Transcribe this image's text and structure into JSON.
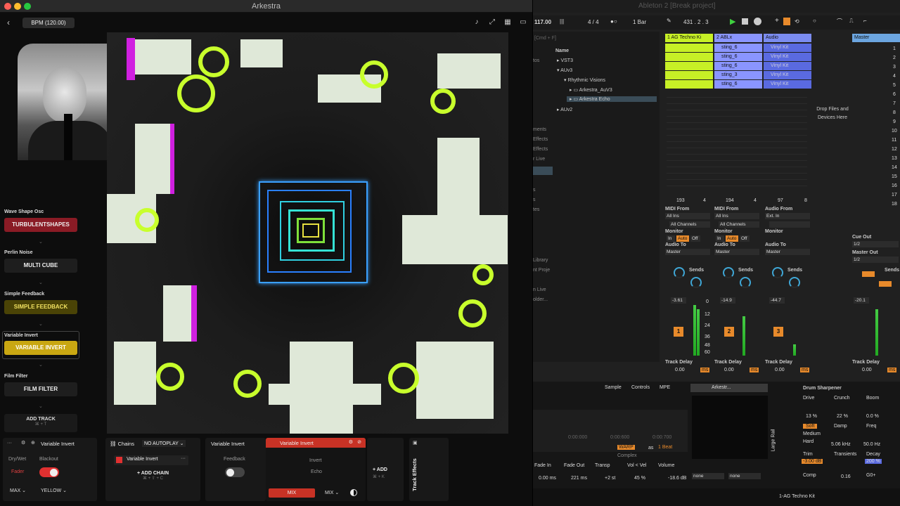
{
  "arkestra": {
    "title": "Arkestra",
    "bpm": "BPM (120.00)",
    "tracks": [
      {
        "label": "Wave Shape Osc",
        "button": "TURBULENTSHAPES",
        "color": "#8a1b25"
      },
      {
        "label": "Perlin Noise",
        "button": "MULTI CUBE",
        "color": "#1e1e1e"
      },
      {
        "label": "Simple Feedback",
        "button": "SIMPLE FEEDBACK",
        "color": "#4a4306"
      },
      {
        "label": "Variable Invert",
        "button": "VARIABLE INVERT",
        "color": "#c9a712"
      },
      {
        "label": "Film Filter",
        "button": "FILM FILTER",
        "color": "#1e1e1e"
      }
    ],
    "add_track": "ADD TRACK",
    "add_track_shortcut": "⌘ + T",
    "bottom": {
      "track_header": "Variable Invert",
      "dry_wet": "Dry/Wet",
      "blackout": "Blackout",
      "fader": "Fader",
      "max": "MAX",
      "yellow": "YELLOW",
      "chains": "Chains",
      "no_autoplay": "NO AUTOPLAY",
      "chain_item": "Variable Invert",
      "add_chain": "+ ADD CHAIN",
      "add_chain_shortcut": "⌘ + ⇧ + C",
      "effect_header": "Variable Invert",
      "feedback": "Feedback",
      "active_effect": "Variable Invert",
      "invert": "Invert",
      "echo": "Echo",
      "mix": "MIX",
      "mix2": "MIX",
      "add": "+ ADD",
      "add_shortcut": "⌘ + K",
      "track_effects": "Track Effects"
    }
  },
  "ableton": {
    "title": "Ableton 2 [Break project]",
    "tempo": "117.00",
    "signature": "4 / 4",
    "bar": "1 Bar",
    "position": "431 .  2 .  3",
    "browser": {
      "search": "[Cmd + F]",
      "name_header": "Name",
      "items": [
        "VST3",
        "AUv3",
        "Rhythmic Visions",
        "Arkestra_AuV3",
        "Arkestra Echo",
        "AUv2"
      ],
      "side": [
        "tos",
        "ments",
        "Effects",
        "Effects",
        "r Live",
        "s",
        "s",
        "tes",
        "Library",
        "nt Proje",
        "n Live",
        "older..."
      ]
    },
    "tracks": [
      {
        "name": "1 AG Techno Ki",
        "color": "#c7f026",
        "clips": [
          "",
          "",
          "",
          "",
          ""
        ],
        "number": "1"
      },
      {
        "name": "2 ABLx",
        "color": "#8a95ff",
        "clips": [
          "sting_6",
          "sting_6",
          "sting_6",
          "sting_3",
          "sting_6"
        ],
        "number": "2"
      },
      {
        "name": "Audio",
        "color": "#7b8cf0",
        "clips": [
          "Vinyl Kit",
          "Vinyl Kit",
          "Vinyl Kit",
          "Vinyl Kit",
          "Vinyl Kit"
        ],
        "number": "3"
      }
    ],
    "master": "Master",
    "drop": "Drop Files and Devices Here",
    "scene_numbers": [
      "1",
      "2",
      "3",
      "4",
      "5",
      "6",
      "7",
      "8",
      "9",
      "10",
      "11",
      "12",
      "13",
      "14",
      "15",
      "16",
      "17",
      "18"
    ],
    "mixer": {
      "midi_from": "MIDI From",
      "audio_from": "Audio From",
      "all_ins": "All Ins",
      "ext_in": "Ext. In",
      "all_channels": "All Channels",
      "monitor": "Monitor",
      "in": "In",
      "auto": "Auto",
      "off": "Off",
      "audio_to": "Audio To",
      "master": "Master",
      "sends": "Sends",
      "cue_out": "Cue Out",
      "cue_val": "1/2",
      "master_out": "Master Out",
      "master_out_val": "1/2",
      "vol": [
        "-3.61",
        "-14.9",
        "-44.7",
        "-20.1"
      ],
      "counts": [
        "193",
        "194",
        "97"
      ],
      "count_nums": [
        "4",
        "4",
        "8"
      ],
      "db": [
        "0",
        "12",
        "24",
        "36",
        "48",
        "60"
      ],
      "track_delay": "Track Delay",
      "delay_val": "0.00",
      "ms": "ms"
    },
    "bottom": {
      "tabs": [
        "Sample",
        "Controls",
        "MPE"
      ],
      "device": "Arkestr...",
      "drum": "Drum Sharpener",
      "drive": "Drive",
      "drive_v": "13 %",
      "crunch": "Crunch",
      "crunch_v": "22 %",
      "boom": "Boom",
      "boom_v": "0.0 %",
      "soft": "Soft",
      "medium": "Medium",
      "hard": "Hard",
      "damp": "Damp",
      "damp_v": "5.06 kHz",
      "freq": "Freq",
      "freq_v": "50.0 Hz",
      "trim": "Trim",
      "trim_v": "-3.00 dB",
      "transients": "Transients",
      "transients_v": "0.16",
      "decay": "Decay",
      "decay_v": "200 %",
      "comp": "Comp",
      "go": "G0+",
      "fade_in": "Fade In",
      "fade_in_v": "0.00 ms",
      "fade_out": "Fade Out",
      "fade_out_v": "221 ms",
      "transp": "Transp",
      "transp_v": "+2 st",
      "vol_vel": "Vol < Vel",
      "vol_vel_v": "45 %",
      "volume": "Volume",
      "volume_v": "-18.6 dB",
      "warp": "WARP",
      "as": "as",
      "beat": "1 Beat",
      "complex": "Complex",
      "none1": "none",
      "none2": "none",
      "large_rail": "Large Rail",
      "footer": "1-AG Techno Kit",
      "times": [
        "0:00:000",
        "0:00:600",
        "0:00:700"
      ]
    }
  }
}
